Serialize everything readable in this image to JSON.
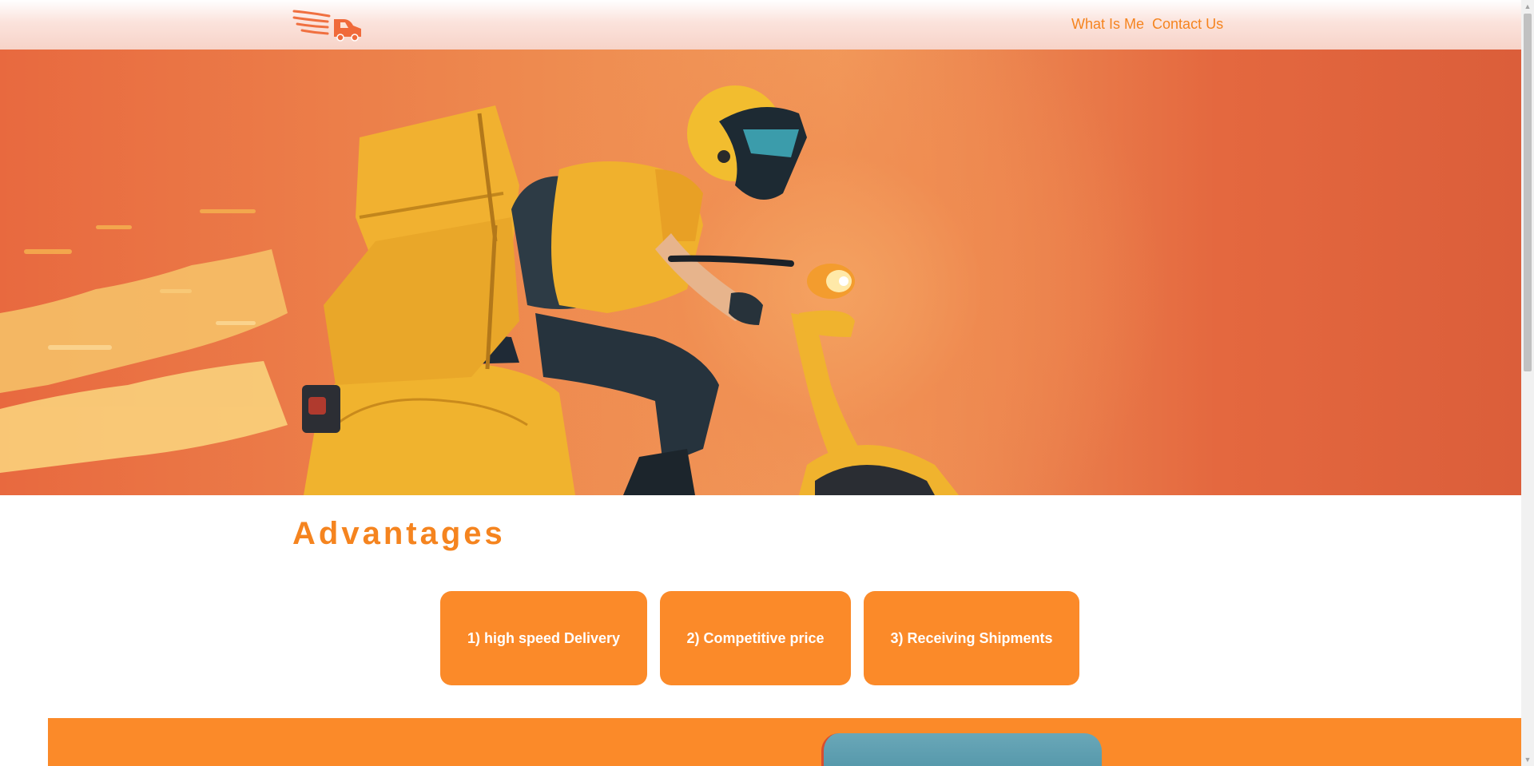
{
  "header": {
    "logo_icon": "delivery-truck-logo-icon",
    "nav": {
      "what_is_me": "What Is Me",
      "contact_us": "Contact Us"
    }
  },
  "hero": {
    "image": "delivery-courier-on-scooter-illustration"
  },
  "advantages": {
    "title": "Advantages",
    "cards": [
      {
        "label": "1) high speed Delivery"
      },
      {
        "label": "2) Competitive price"
      },
      {
        "label": "3) Receiving Shipments"
      }
    ]
  },
  "colors": {
    "accent": "#f5841f",
    "card": "#fb8a29",
    "hero_left": "#e8693f",
    "hero_right": "#db5e3a",
    "band_card": "#5a9db0"
  }
}
